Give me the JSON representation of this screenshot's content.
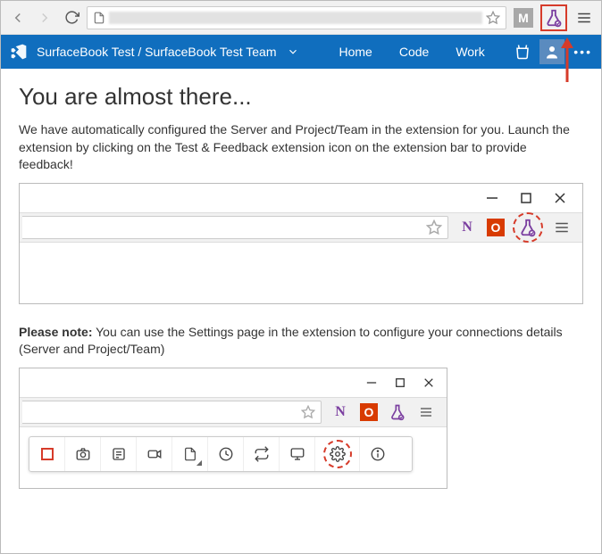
{
  "chrome": {
    "m_label": "M",
    "flask_name": "flask-icon"
  },
  "nav": {
    "project": "SurfaceBook Test / SurfaceBook Test Team",
    "links": {
      "home": "Home",
      "code": "Code",
      "work": "Work"
    },
    "ellipsis": "•••"
  },
  "page": {
    "heading": "You are almost there...",
    "para1": "We have automatically configured the Server and Project/Team in the extension for you. Launch the extension by clicking on the Test & Feedback extension icon on the extension bar to provide feedback!",
    "note_label": "Please note:",
    "note_text": " You can use the Settings page in the extension to configure your connections details (Server and Project/Team)"
  },
  "shot_icons": {
    "n": "N",
    "o": "O"
  }
}
